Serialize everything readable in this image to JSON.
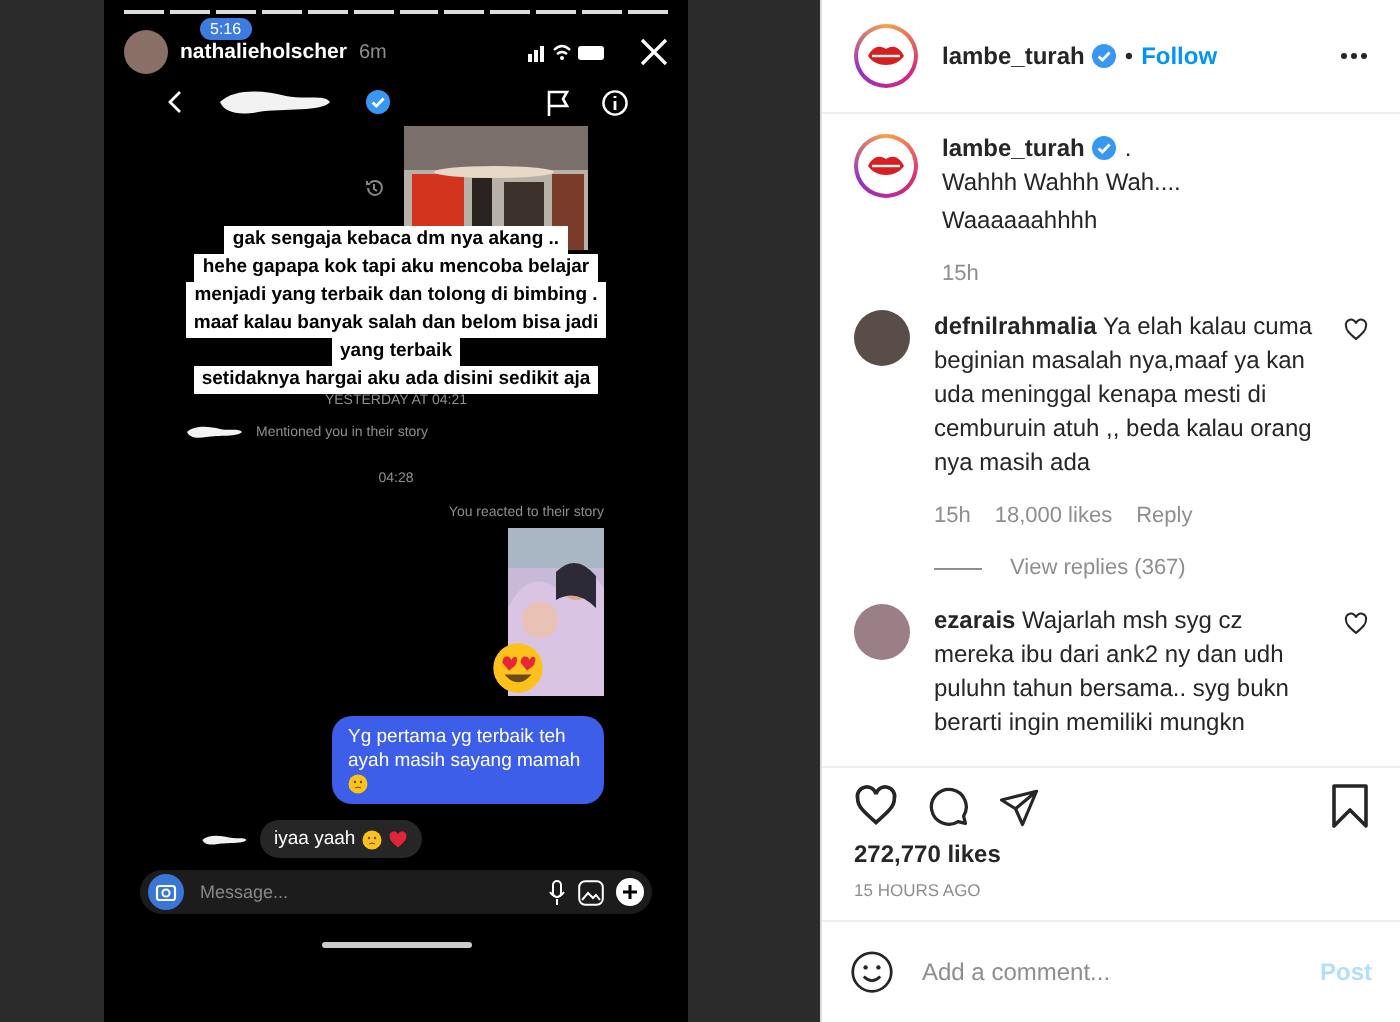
{
  "story": {
    "username": "nathalieholscher",
    "age": "6m",
    "clock": "5:16",
    "stickers": [
      "gak sengaja kebaca dm nya akang ..",
      "hehe gapapa kok tapi aku mencoba belajar",
      "menjadi yang terbaik dan tolong di bimbing .",
      "maaf kalau banyak salah dan belom bisa jadi",
      "yang terbaik",
      "setidaknya hargai aku ada disini sedikit aja"
    ],
    "timestamp": "YESTERDAY AT 04:21",
    "mention": "Mentioned you in their story",
    "time": "04:28",
    "reaction_note": "You reacted to their story",
    "sent_message": "Yg pertama yg terbaik teh ayah masih sayang mamah",
    "reply": "iyaa yaah",
    "composer": {
      "placeholder": "Message..."
    }
  },
  "post": {
    "username": "lambe_turah",
    "separator": "•",
    "follow": "Follow",
    "caption": {
      "username": "lambe_turah",
      "dot": ".",
      "lines": [
        "Wahhh Wahhh Wah....",
        "Waaaaaahhhh"
      ],
      "time": "15h"
    },
    "comments": [
      {
        "username": "defnilrahmalia",
        "text": "Ya elah kalau cuma beginian masalah nya,maaf ya kan uda meninggal kenapa mesti di cemburuin atuh ,, beda kalau orang nya masih ada",
        "time": "15h",
        "likes": "18,000 likes",
        "reply": "Reply",
        "view_replies": "View replies (367)"
      },
      {
        "username": "ezarais",
        "text": "Wajarlah msh syg cz mereka ibu dari ank2 ny dan udh puluhn tahun bersama.. syg bukn berarti ingin memiliki mungkn"
      }
    ],
    "likes": "272,770 likes",
    "posted": "15 HOURS AGO",
    "comment_box": {
      "placeholder": "Add a comment..."
    },
    "post_button": {
      "label": "Post",
      "disabled": true
    }
  }
}
